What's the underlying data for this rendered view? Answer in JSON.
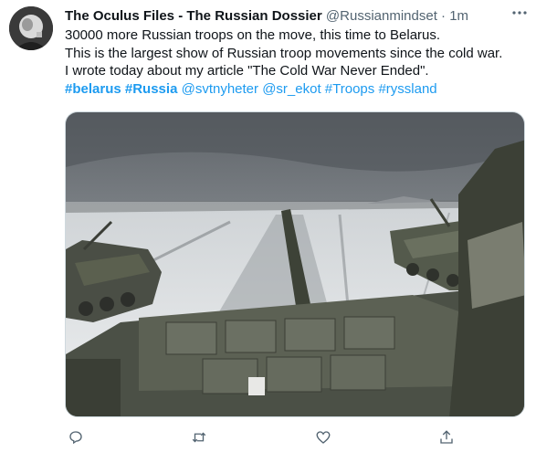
{
  "tweet": {
    "author_name": "The Oculus Files - The Russian Dossier",
    "author_handle": "@Russianmindset",
    "separator": "·",
    "time": "1m",
    "lines": [
      "30000 more Russian troops on the move, this time to Belarus.",
      "This is the largest show of Russian troop movements since the cold war.",
      "I wrote today about my article \"The Cold War Never Ended\"."
    ],
    "tags": [
      {
        "text": "#belarus",
        "bold": true
      },
      {
        "text": "#Russia",
        "bold": true
      },
      {
        "text": "@svtnyheter",
        "bold": false
      },
      {
        "text": "@sr_ekot",
        "bold": false
      },
      {
        "text": "#Troops",
        "bold": false
      },
      {
        "text": "#ryssland",
        "bold": false
      }
    ],
    "more_icon": "more-dots-icon",
    "action_icons": [
      "reply-icon",
      "retweet-icon",
      "like-icon",
      "share-icon"
    ]
  },
  "colors": {
    "text": "#0f1419",
    "muted": "#536471",
    "link": "#1d9bf0"
  }
}
